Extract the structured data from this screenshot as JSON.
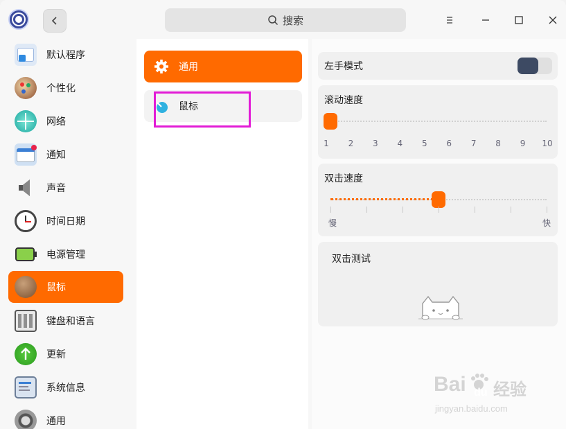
{
  "titlebar": {
    "search_placeholder": "搜索",
    "back_icon": "chevron-left-icon",
    "menu_icon": "menu-icon",
    "minimize_icon": "minimize-icon",
    "maximize_icon": "maximize-icon",
    "close_icon": "close-icon"
  },
  "sidebar": {
    "items": [
      {
        "label": "默认程序",
        "icon": "default-apps-icon"
      },
      {
        "label": "个性化",
        "icon": "personalization-icon"
      },
      {
        "label": "网络",
        "icon": "network-icon"
      },
      {
        "label": "通知",
        "icon": "notification-icon"
      },
      {
        "label": "声音",
        "icon": "sound-icon"
      },
      {
        "label": "时间日期",
        "icon": "clock-icon"
      },
      {
        "label": "电源管理",
        "icon": "battery-icon"
      },
      {
        "label": "鼠标",
        "icon": "mouse-icon",
        "active": true
      },
      {
        "label": "键盘和语言",
        "icon": "keyboard-icon"
      },
      {
        "label": "更新",
        "icon": "update-icon"
      },
      {
        "label": "系统信息",
        "icon": "system-info-icon"
      },
      {
        "label": "通用",
        "icon": "general-icon"
      }
    ]
  },
  "middle": {
    "items": [
      {
        "label": "通用",
        "icon": "gear-icon",
        "active": true
      },
      {
        "label": "鼠标",
        "icon": "mouse-icon"
      }
    ]
  },
  "right": {
    "left_hand": {
      "label": "左手模式",
      "enabled": true
    },
    "scroll_speed": {
      "label": "滚动速度",
      "value": 1,
      "ticks": [
        "1",
        "2",
        "3",
        "4",
        "5",
        "6",
        "7",
        "8",
        "9",
        "10"
      ]
    },
    "double_click_speed": {
      "label": "双击速度",
      "value_fraction": 0.5,
      "slow_label": "慢",
      "fast_label": "快"
    },
    "double_click_test": {
      "label": "双击测试"
    }
  },
  "watermark": {
    "brand": "Bai",
    "brand2": "du",
    "brand_cn": "经验",
    "url": "jingyan.baidu.com"
  },
  "colors": {
    "accent": "#ff6a00",
    "highlight_box": "#e21bd6",
    "toggle_on": "#3d4a63"
  }
}
